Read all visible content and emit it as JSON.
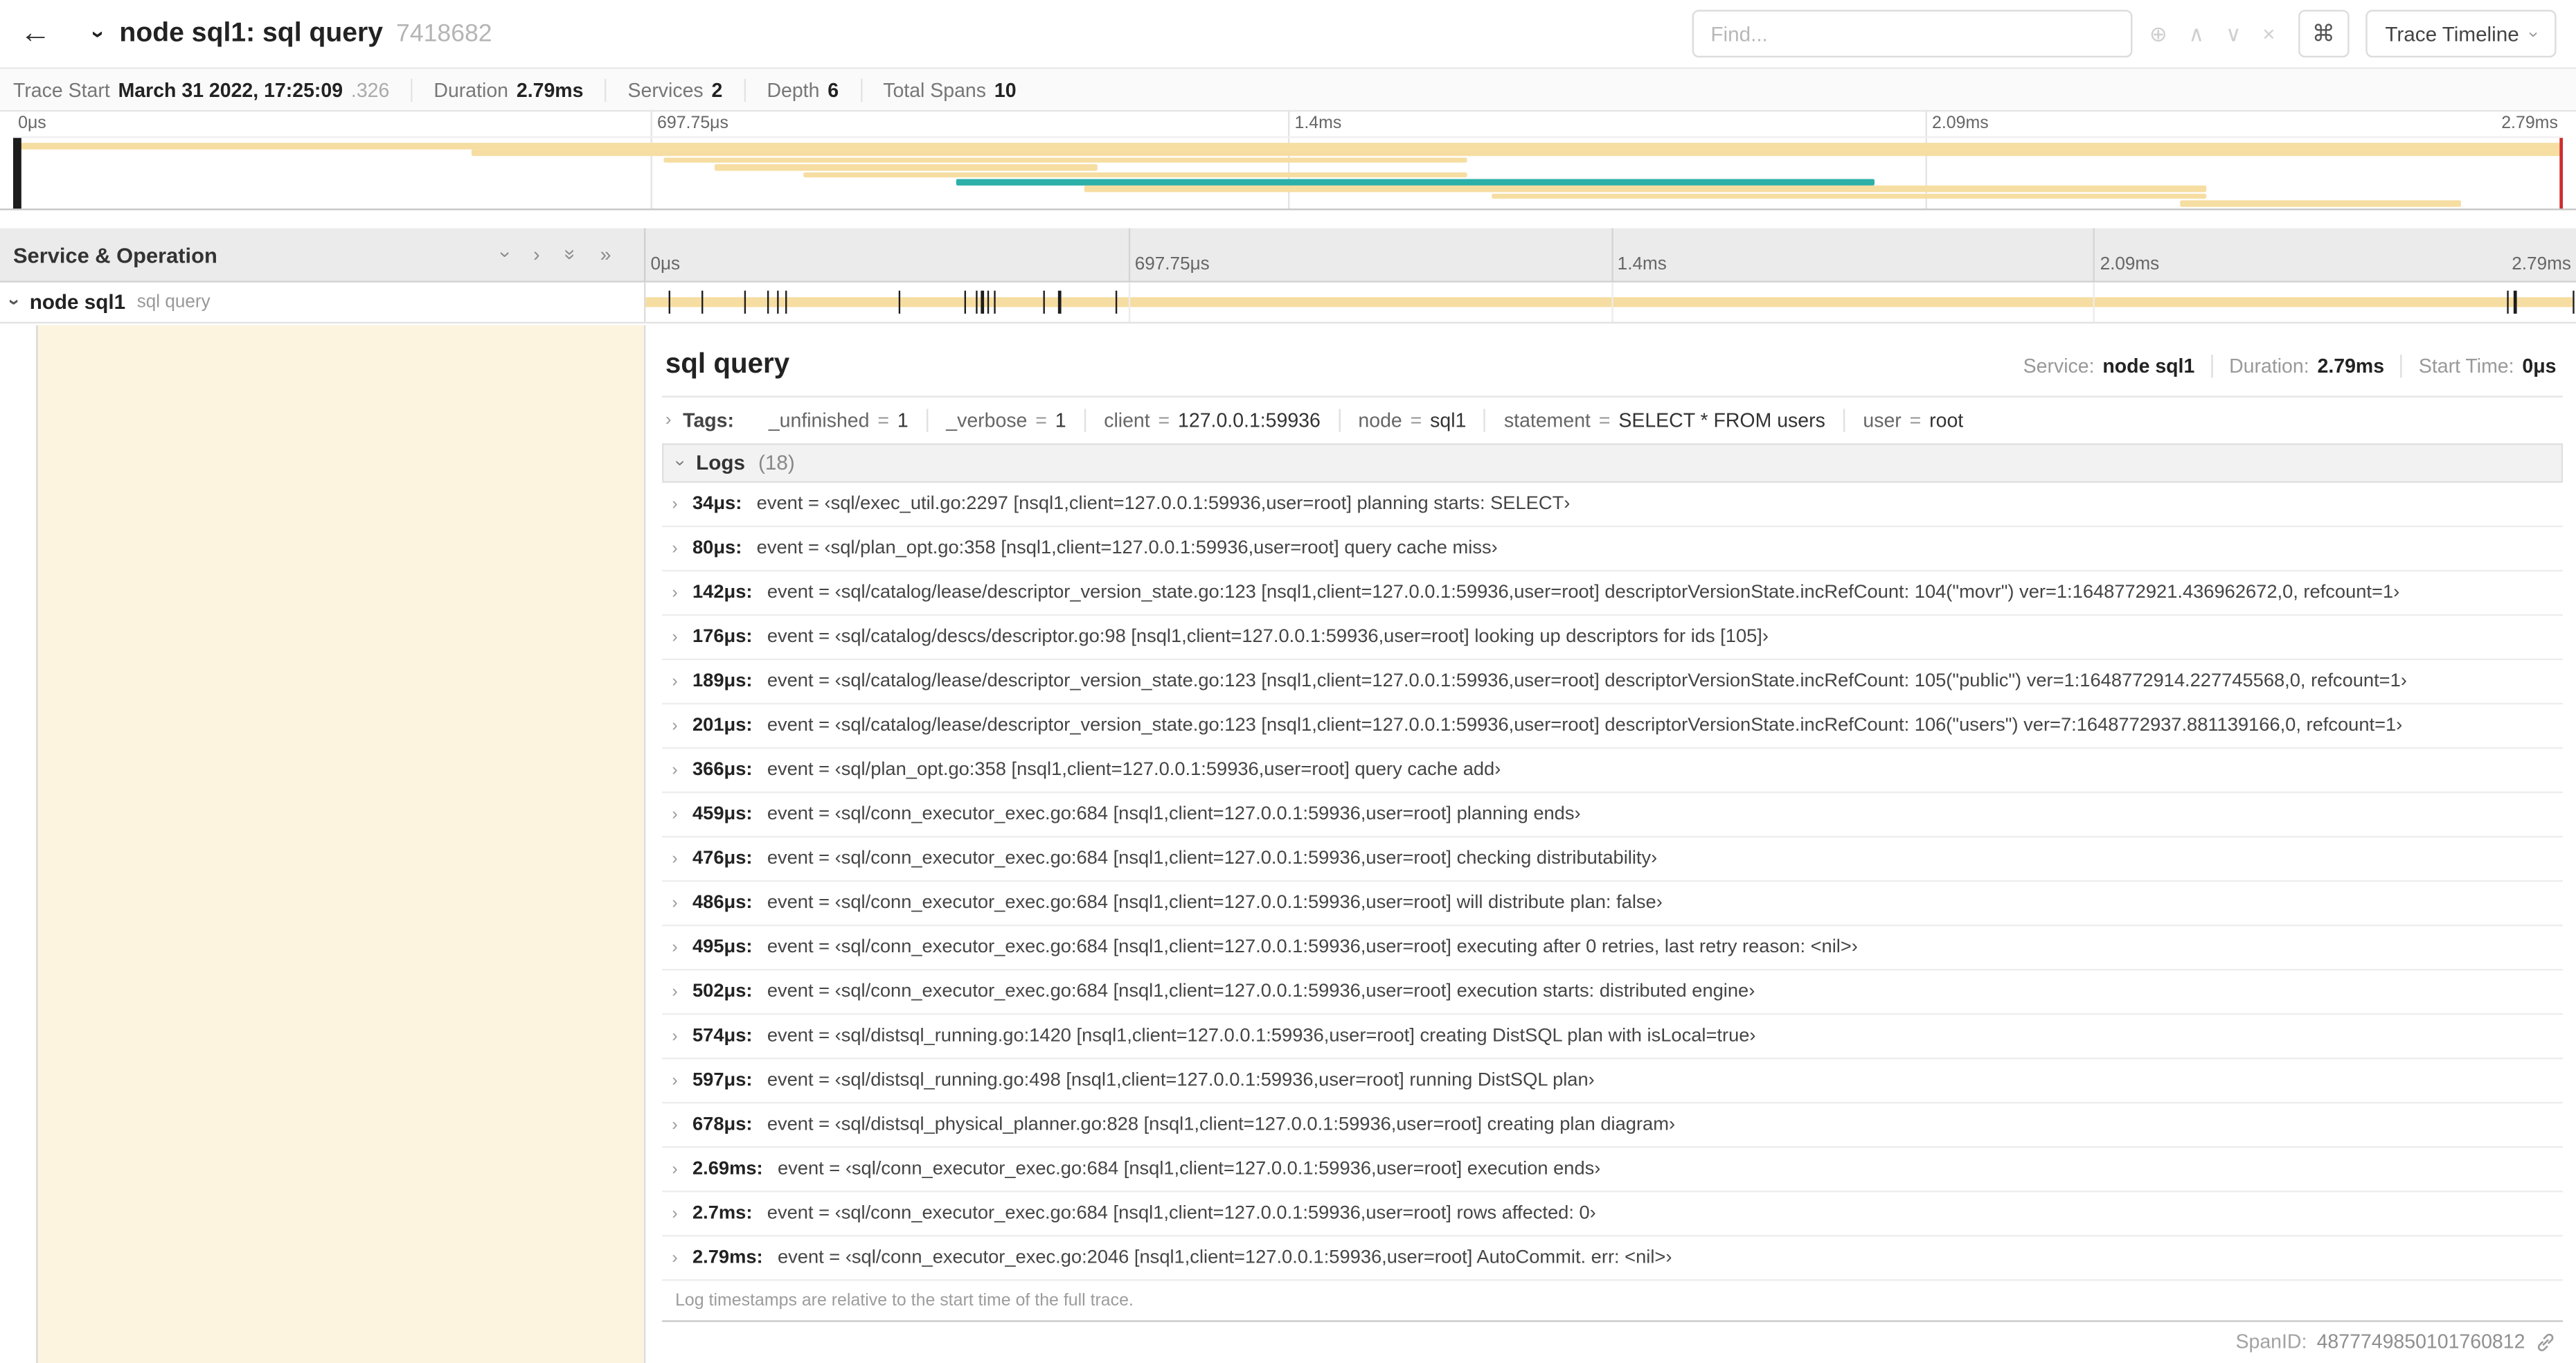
{
  "colors": {
    "span": "#f6dda1",
    "accent": "#2cb0a8",
    "tint": "#fcf4df",
    "scrubber": "#cf2d2d"
  },
  "icons": {
    "back": "←",
    "chevron": "›",
    "double_chevron": "»",
    "locate": "⊕",
    "prev": "∧",
    "next": "∨",
    "clear": "×",
    "command": "⌘",
    "equals": "="
  },
  "header": {
    "title": "node sql1: sql query",
    "trace_id": "7418682",
    "find_placeholder": "Find...",
    "view_button": "Trace Timeline"
  },
  "trace_info": [
    {
      "label": "Trace Start",
      "value": "March 31 2022, 17:25:09",
      "suffix": ".326"
    },
    {
      "label": "Duration",
      "value": "2.79ms"
    },
    {
      "label": "Services",
      "value": "2"
    },
    {
      "label": "Depth",
      "value": "6"
    },
    {
      "label": "Total Spans",
      "value": "10"
    }
  ],
  "minimap": {
    "axis": [
      {
        "label": "0μs",
        "pct": 0
      },
      {
        "label": "697.75μs",
        "pct": 25
      },
      {
        "label": "1.4ms",
        "pct": 50
      },
      {
        "label": "2.09ms",
        "pct": 75
      },
      {
        "label": "2.79ms",
        "pct": 100
      }
    ],
    "bars": [
      {
        "r": 0,
        "l": 0,
        "w": 100,
        "c": "span"
      },
      {
        "r": 1,
        "l": 18,
        "w": 82,
        "c": "span"
      },
      {
        "r": 2,
        "l": 25.5,
        "w": 31.5,
        "c": "span"
      },
      {
        "r": 3,
        "l": 27.5,
        "w": 15,
        "c": "span"
      },
      {
        "r": 4,
        "l": 31,
        "w": 26,
        "c": "span"
      },
      {
        "r": 5,
        "l": 37,
        "w": 36,
        "c": "accent"
      },
      {
        "r": 6,
        "l": 42,
        "w": 44,
        "c": "span"
      },
      {
        "r": 7,
        "l": 58,
        "w": 28,
        "c": "span"
      },
      {
        "r": 8,
        "l": 85,
        "w": 11,
        "c": "span"
      }
    ]
  },
  "timeline": {
    "left_header": "Service & Operation",
    "axis": [
      {
        "label": "0μs",
        "pct": 0
      },
      {
        "label": "697.75μs",
        "pct": 25
      },
      {
        "label": "1.4ms",
        "pct": 50
      },
      {
        "label": "2.09ms",
        "pct": 75
      },
      {
        "label": "2.79ms",
        "pct": 100
      }
    ],
    "row": {
      "service": "node sql1",
      "operation": "sql query"
    },
    "ticks_pct": [
      1.2,
      2.9,
      5.1,
      6.3,
      6.8,
      7.2,
      13.1,
      16.5,
      17.1,
      17.4,
      17.7,
      18.0,
      20.6,
      21.4,
      24.3,
      96.4,
      96.8,
      99.8
    ]
  },
  "detail": {
    "title": "sql query",
    "meta": [
      {
        "label": "Service:",
        "value": "node sql1"
      },
      {
        "label": "Duration:",
        "value": "2.79ms"
      },
      {
        "label": "Start Time:",
        "value": "0μs"
      }
    ],
    "tags_label": "Tags:",
    "tags": [
      {
        "key": "_unfinished",
        "value": "1"
      },
      {
        "key": "_verbose",
        "value": "1"
      },
      {
        "key": "client",
        "value": "127.0.0.1:59936"
      },
      {
        "key": "node",
        "value": "sql1"
      },
      {
        "key": "statement",
        "value": "SELECT * FROM users"
      },
      {
        "key": "user",
        "value": "root"
      }
    ],
    "logs_title": "Logs",
    "logs_count": "(18)",
    "logs": [
      {
        "time": "34μs:",
        "text": "event = ‹sql/exec_util.go:2297 [nsql1,client=127.0.0.1:59936,user=root] planning starts: SELECT›"
      },
      {
        "time": "80μs:",
        "text": "event = ‹sql/plan_opt.go:358 [nsql1,client=127.0.0.1:59936,user=root] query cache miss›"
      },
      {
        "time": "142μs:",
        "text": "event = ‹sql/catalog/lease/descriptor_version_state.go:123 [nsql1,client=127.0.0.1:59936,user=root] descriptorVersionState.incRefCount: 104(\"movr\") ver=1:1648772921.436962672,0, refcount=1›"
      },
      {
        "time": "176μs:",
        "text": "event = ‹sql/catalog/descs/descriptor.go:98 [nsql1,client=127.0.0.1:59936,user=root] looking up descriptors for ids [105]›"
      },
      {
        "time": "189μs:",
        "text": "event = ‹sql/catalog/lease/descriptor_version_state.go:123 [nsql1,client=127.0.0.1:59936,user=root] descriptorVersionState.incRefCount: 105(\"public\") ver=1:1648772914.227745568,0, refcount=1›"
      },
      {
        "time": "201μs:",
        "text": "event = ‹sql/catalog/lease/descriptor_version_state.go:123 [nsql1,client=127.0.0.1:59936,user=root] descriptorVersionState.incRefCount: 106(\"users\") ver=7:1648772937.881139166,0, refcount=1›"
      },
      {
        "time": "366μs:",
        "text": "event = ‹sql/plan_opt.go:358 [nsql1,client=127.0.0.1:59936,user=root] query cache add›"
      },
      {
        "time": "459μs:",
        "text": "event = ‹sql/conn_executor_exec.go:684 [nsql1,client=127.0.0.1:59936,user=root] planning ends›"
      },
      {
        "time": "476μs:",
        "text": "event = ‹sql/conn_executor_exec.go:684 [nsql1,client=127.0.0.1:59936,user=root] checking distributability›"
      },
      {
        "time": "486μs:",
        "text": "event = ‹sql/conn_executor_exec.go:684 [nsql1,client=127.0.0.1:59936,user=root] will distribute plan: false›"
      },
      {
        "time": "495μs:",
        "text": "event = ‹sql/conn_executor_exec.go:684 [nsql1,client=127.0.0.1:59936,user=root] executing after 0 retries, last retry reason: <nil>›"
      },
      {
        "time": "502μs:",
        "text": "event = ‹sql/conn_executor_exec.go:684 [nsql1,client=127.0.0.1:59936,user=root] execution starts: distributed engine›"
      },
      {
        "time": "574μs:",
        "text": "event = ‹sql/distsql_running.go:1420 [nsql1,client=127.0.0.1:59936,user=root] creating DistSQL plan with isLocal=true›"
      },
      {
        "time": "597μs:",
        "text": "event = ‹sql/distsql_running.go:498 [nsql1,client=127.0.0.1:59936,user=root] running DistSQL plan›"
      },
      {
        "time": "678μs:",
        "text": "event = ‹sql/distsql_physical_planner.go:828 [nsql1,client=127.0.0.1:59936,user=root] creating plan diagram›"
      },
      {
        "time": "2.69ms:",
        "text": "event = ‹sql/conn_executor_exec.go:684 [nsql1,client=127.0.0.1:59936,user=root] execution ends›"
      },
      {
        "time": "2.7ms:",
        "text": "event = ‹sql/conn_executor_exec.go:684 [nsql1,client=127.0.0.1:59936,user=root] rows affected: 0›"
      },
      {
        "time": "2.79ms:",
        "text": "event = ‹sql/conn_executor_exec.go:2046 [nsql1,client=127.0.0.1:59936,user=root] AutoCommit. err: <nil>›"
      }
    ],
    "note": "Log timestamps are relative to the start time of the full trace.",
    "spanid_label": "SpanID:",
    "spanid": "4877749850101760812"
  }
}
